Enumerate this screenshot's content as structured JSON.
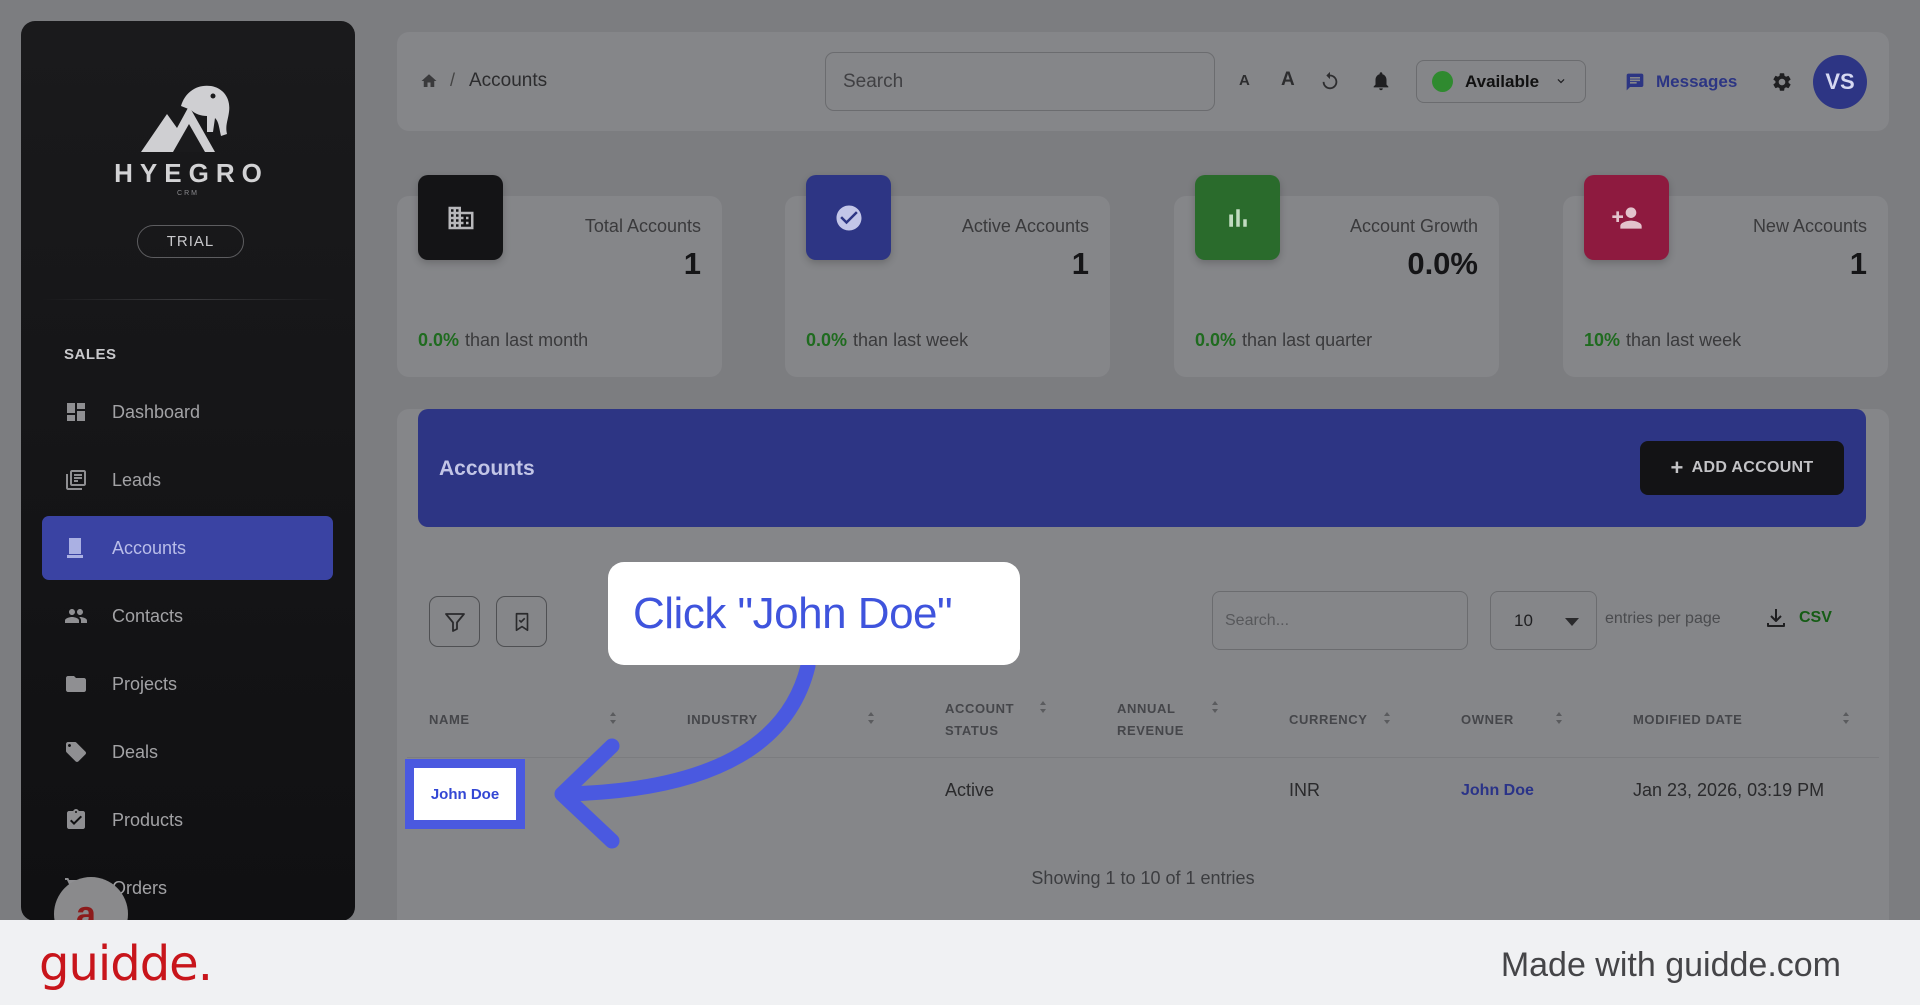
{
  "sidebar": {
    "logo_text": "HYEGRO",
    "logo_sub": "CRM",
    "plan_badge": "TRIAL",
    "section_label": "SALES",
    "items": [
      {
        "label": "Dashboard",
        "icon": "dashboard-icon"
      },
      {
        "label": "Leads",
        "icon": "leads-icon"
      },
      {
        "label": "Accounts",
        "icon": "accounts-icon",
        "active": true
      },
      {
        "label": "Contacts",
        "icon": "contacts-icon"
      },
      {
        "label": "Projects",
        "icon": "folder-icon"
      },
      {
        "label": "Deals",
        "icon": "tag-icon"
      },
      {
        "label": "Products",
        "icon": "clipboard-check-icon"
      },
      {
        "label": "Orders",
        "icon": "cart-icon"
      }
    ],
    "help_bubble": "a."
  },
  "topbar": {
    "breadcrumb_current": "Accounts",
    "breadcrumb_sep": "/",
    "search_placeholder": "Search",
    "font_small": "A",
    "font_large": "A",
    "status_label": "Available",
    "status_color": "#2f8a2f",
    "messages_label": "Messages",
    "avatar_initials": "VS"
  },
  "stats": [
    {
      "title": "Total Accounts",
      "value": "1",
      "pct": "0.0%",
      "suffix": "than last month",
      "icon": "building-icon",
      "color": "#141416"
    },
    {
      "title": "Active Accounts",
      "value": "1",
      "pct": "0.0%",
      "suffix": "than last week",
      "icon": "check-circle-icon",
      "color": "#2d3584"
    },
    {
      "title": "Account Growth",
      "value": "0.0%",
      "pct": "0.0%",
      "suffix": "than last quarter",
      "icon": "bar-chart-icon",
      "color": "#2a6b2c"
    },
    {
      "title": "New Accounts",
      "value": "1",
      "pct": "10%",
      "suffix": "than last week",
      "icon": "person-add-icon",
      "color": "#8e1a3f"
    }
  ],
  "panel": {
    "title": "Accounts",
    "add_button": "ADD ACCOUNT",
    "search_placeholder": "Search...",
    "entries_value": "10",
    "entries_label": "entries per page",
    "csv_label": "CSV",
    "columns": [
      "NAME",
      "INDUSTRY",
      "ACCOUNT STATUS",
      "ANNUAL REVENUE",
      "CURRENCY",
      "OWNER",
      "MODIFIED DATE"
    ],
    "columns_display": {
      "name": "NAME",
      "industry": "INDUSTRY",
      "status_line1": "ACCOUNT",
      "status_line2": "STATUS",
      "revenue_line1": "ANNUAL",
      "revenue_line2": "REVENUE",
      "currency": "CURRENCY",
      "owner": "OWNER",
      "modified": "MODIFIED DATE"
    },
    "rows": [
      {
        "name": "John Doe",
        "industry": "",
        "status": "Active",
        "revenue": "",
        "currency": "INR",
        "owner": "John Doe",
        "modified": "Jan 23, 2026, 03:19 PM"
      }
    ],
    "showing": "Showing 1 to 10 of 1 entries"
  },
  "tooltip": {
    "text": "Click \"John Doe\""
  },
  "footer": {
    "brand": "guidde.",
    "made_with": "Made with guidde.com"
  }
}
